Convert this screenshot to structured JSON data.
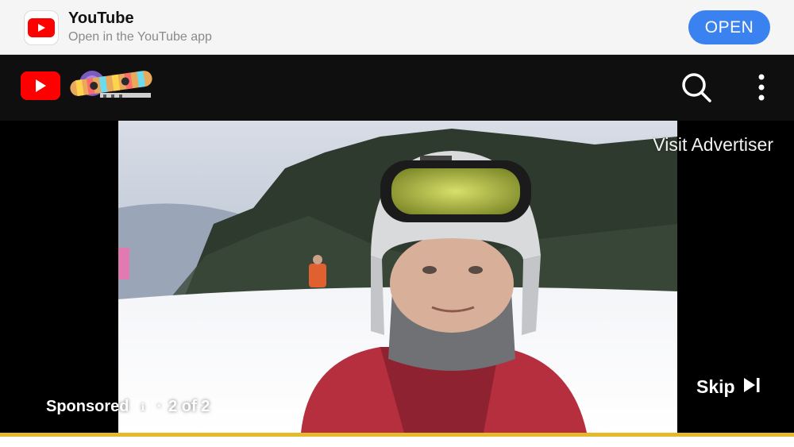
{
  "app_banner": {
    "title": "YouTube",
    "subtitle": "Open in the YouTube app",
    "open_label": "OPEN",
    "icon": "youtube-app-icon"
  },
  "header": {
    "logo_icon": "youtube-logo-icon",
    "doodle_icon": "snowboard-doodle-icon",
    "search_icon": "search-icon",
    "more_icon": "more-vertical-icon"
  },
  "ad": {
    "visit_advertiser": "Visit Advertiser",
    "sponsored": "Sponsored",
    "separator": "·",
    "ad_count": "2 of 2",
    "skip_label": "Skip",
    "progress": 1.0
  },
  "colors": {
    "banner_bg": "#f5f5f5",
    "open_button": "#3b82f1",
    "header_bg": "#0f0f0f",
    "youtube_red": "#ff0000",
    "progress": "#e4b92c"
  }
}
